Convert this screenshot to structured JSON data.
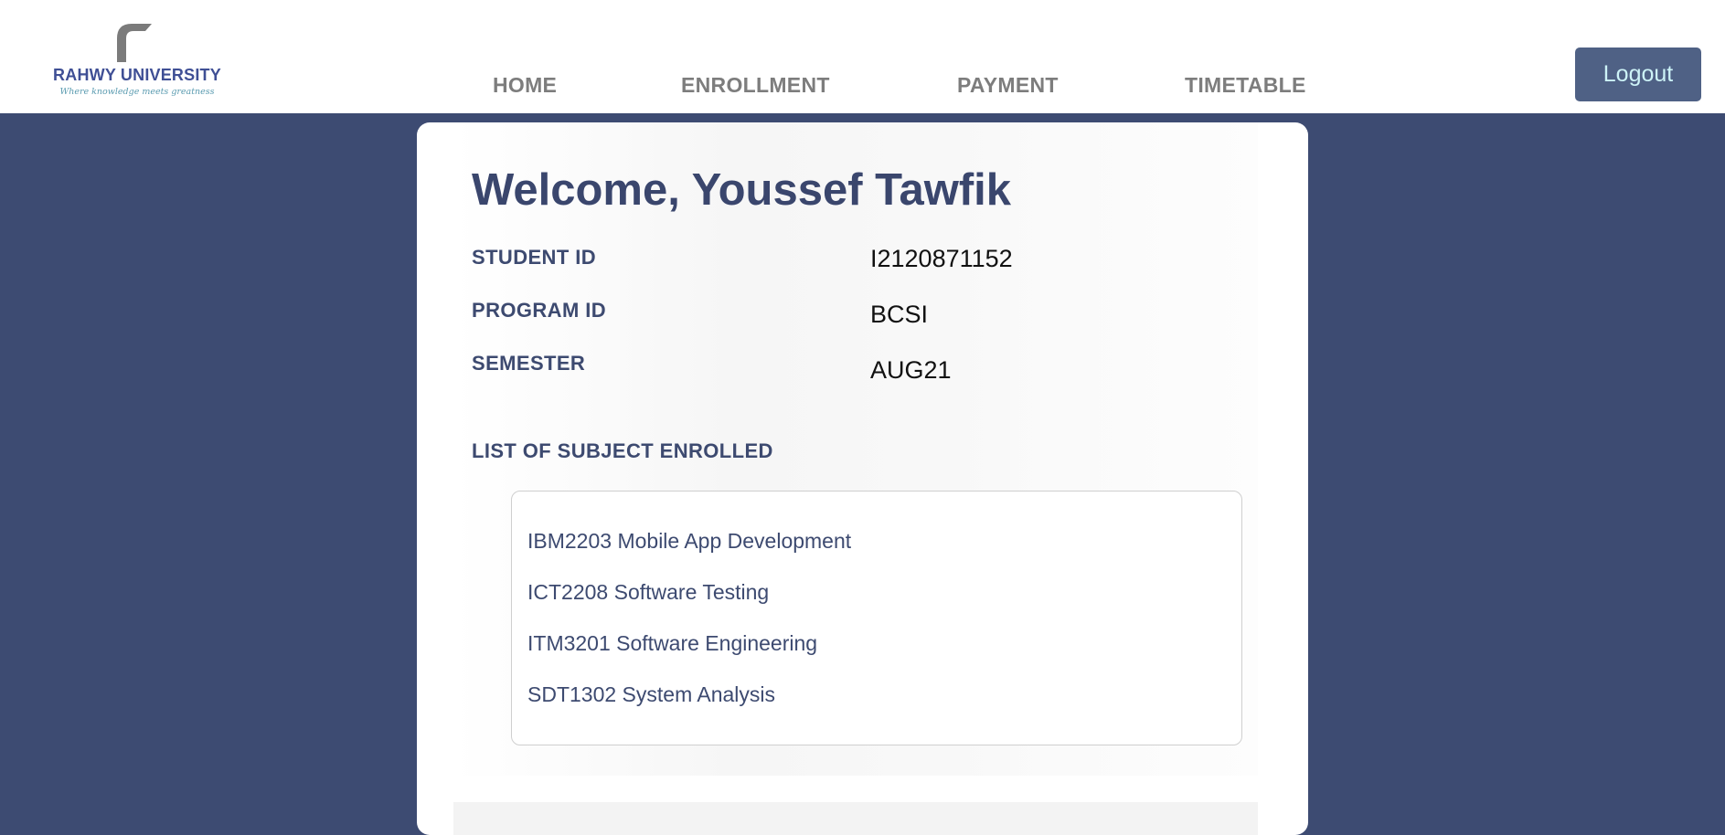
{
  "brand": {
    "name": "RAHWY UNIVERSITY",
    "tagline": "Where knowledge meets greatness"
  },
  "nav": {
    "items": [
      {
        "label": "HOME"
      },
      {
        "label": "ENROLLMENT"
      },
      {
        "label": "PAYMENT"
      },
      {
        "label": "TIMETABLE"
      }
    ],
    "logout_label": "Logout"
  },
  "main": {
    "welcome": "Welcome, Youssef Tawfik",
    "info": [
      {
        "label": "STUDENT ID",
        "value": "I2120871152"
      },
      {
        "label": "PROGRAM ID",
        "value": "BCSI"
      },
      {
        "label": "SEMESTER",
        "value": "AUG21"
      }
    ],
    "subjects_title": "LIST OF SUBJECT ENROLLED",
    "subjects": [
      "IBM2203 Mobile App Development",
      "ICT2208 Software Testing",
      "ITM3201 Software Engineering",
      "SDT1302 System Analysis"
    ]
  },
  "colors": {
    "background": "#3d4b72",
    "accent": "#3a466d",
    "logout_button": "#4f6185"
  }
}
